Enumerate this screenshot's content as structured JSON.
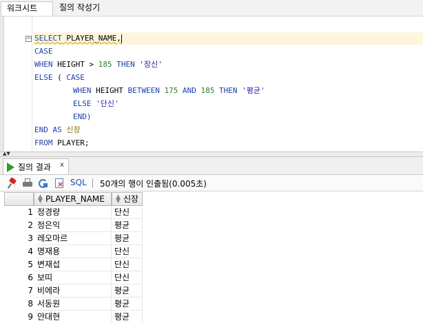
{
  "editor_tabs": {
    "worksheet": "워크시트",
    "query_builder": "질의 작성기"
  },
  "code": {
    "line1": {
      "kw": "SELECT",
      "rest": " PLAYER_NAME,"
    },
    "line2": {
      "kw": "CASE"
    },
    "line3": {
      "kw1": "WHEN",
      "mid": " HEIGHT > ",
      "num": "185",
      "kw2": " THEN ",
      "str": "'장신'"
    },
    "line4": {
      "kw1": "ELSE",
      "mid": " ( ",
      "kw2": "CASE"
    },
    "line5": {
      "kw1": "WHEN",
      "mid": " HEIGHT ",
      "kw2": "BETWEEN",
      "num1": " 175 ",
      "kw3": "AND",
      "num2": " 185 ",
      "kw4": "THEN",
      "str": " '평균'"
    },
    "line6": {
      "kw": "ELSE",
      "str": " '단신'"
    },
    "line7": {
      "kw": "END)"
    },
    "line8": {
      "kw1": "END",
      "kw2": " AS",
      "alias": " 신장"
    },
    "line9": {
      "kw": "FROM",
      "rest": " PLAYER;"
    }
  },
  "result_tab": {
    "label": "질의 결과",
    "close": "x"
  },
  "toolbar": {
    "sql_label": "SQL",
    "status": "50개의 행이 인출됨(0.005초)"
  },
  "grid": {
    "columns": [
      "PLAYER_NAME",
      "신장"
    ],
    "rows": [
      {
        "n": "1",
        "name": "정경량",
        "height": "단신"
      },
      {
        "n": "2",
        "name": "정은익",
        "height": "평균"
      },
      {
        "n": "3",
        "name": "레오마르",
        "height": "평균"
      },
      {
        "n": "4",
        "name": "명재용",
        "height": "단신"
      },
      {
        "n": "5",
        "name": "변재섭",
        "height": "단신"
      },
      {
        "n": "6",
        "name": "보띠",
        "height": "단신"
      },
      {
        "n": "7",
        "name": "비에라",
        "height": "평균"
      },
      {
        "n": "8",
        "name": "서동원",
        "height": "평균"
      },
      {
        "n": "9",
        "name": "안대현",
        "height": "평균"
      }
    ]
  },
  "colors": {
    "keyword": "#1c3fa8",
    "number": "#2b7d2b",
    "current_line": "#fdf6dc",
    "run_icon": "#2e9b2e"
  }
}
